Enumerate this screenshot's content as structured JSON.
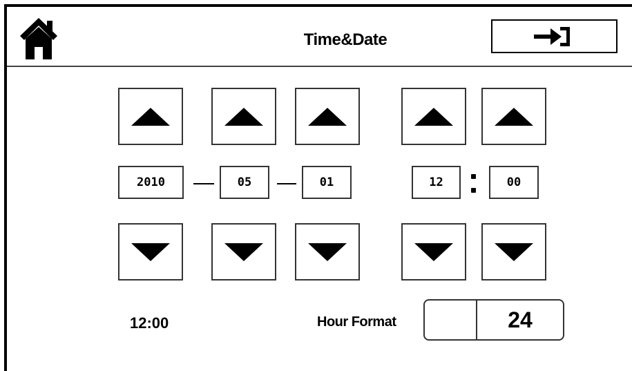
{
  "header": {
    "title": "Time&Date",
    "home_icon": "home-icon",
    "exit_icon": "exit-arrow-icon"
  },
  "date": {
    "year": "2010",
    "month": "05",
    "day": "01"
  },
  "time": {
    "hour": "12",
    "minute": "00",
    "separator": ":"
  },
  "controls": {
    "up_icon": "triangle-up-icon",
    "down_icon": "triangle-down-icon"
  },
  "footer": {
    "current_time": "12:00",
    "hour_format_label": "Hour Format",
    "hour_format_value": "24"
  }
}
